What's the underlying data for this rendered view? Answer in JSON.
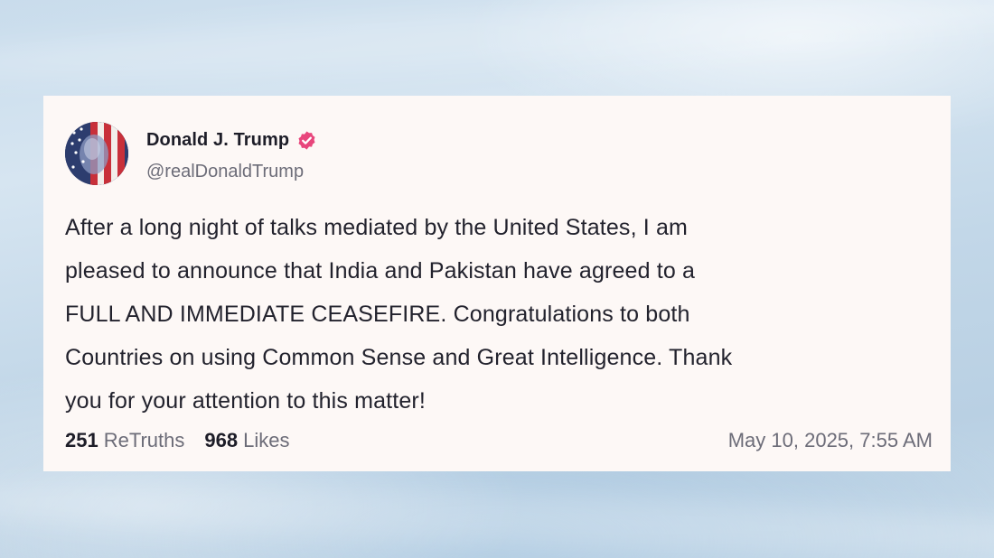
{
  "post": {
    "author": {
      "display_name": "Donald J. Trump",
      "handle": "@realDonaldTrump",
      "verified_icon": "verified-badge-icon",
      "verified_color": "#e8467c"
    },
    "text": "After a long night of talks mediated by the United States, I am\npleased to announce that India and Pakistan have agreed to a\nFULL AND IMMEDIATE CEASEFIRE. Congratulations to both\nCountries on using Common Sense and Great Intelligence. Thank\nyou for your attention to this matter!",
    "stats": {
      "retruths_count": "251",
      "retruths_label": "ReTruths",
      "likes_count": "968",
      "likes_label": "Likes"
    },
    "timestamp": "May 10, 2025, 7:55 AM"
  },
  "colors": {
    "card_background": "#fdf8f6",
    "text_primary": "#22222d",
    "text_secondary": "#6c6c78",
    "verified_badge": "#e8467c"
  }
}
